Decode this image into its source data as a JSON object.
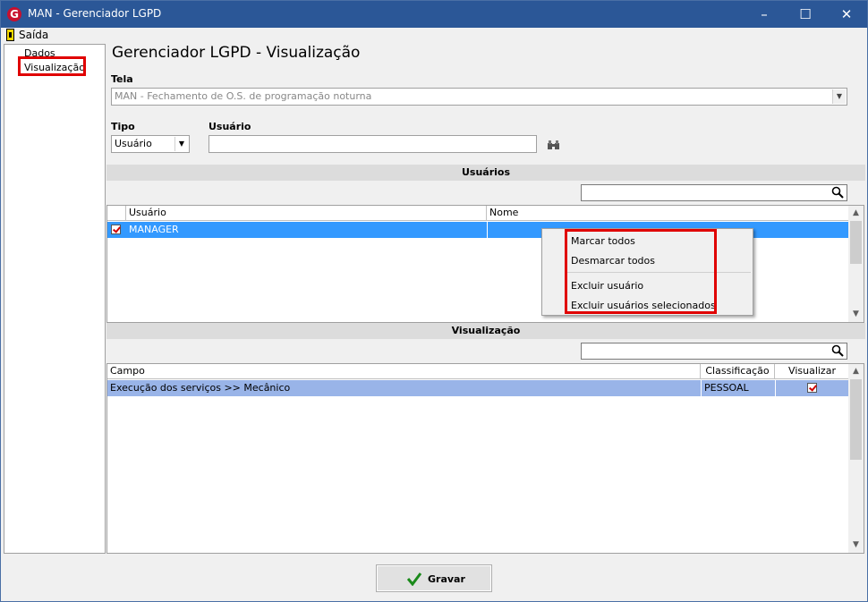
{
  "window": {
    "title": "MAN - Gerenciador LGPD",
    "app_icon_letter": "G"
  },
  "titlebar_buttons": {
    "minimize": "–",
    "maximize": "☐",
    "close": "✕"
  },
  "menubar": {
    "saida": "Saída"
  },
  "tree": {
    "items": [
      "Dados",
      "Visualização"
    ]
  },
  "heading": "Gerenciador LGPD - Visualização",
  "tela": {
    "label": "Tela",
    "value": "MAN - Fechamento de O.S. de programação noturna"
  },
  "tipo": {
    "label": "Tipo",
    "value": "Usuário"
  },
  "usuario_field": {
    "label": "Usuário",
    "value": ""
  },
  "usuarios_section": {
    "title": "Usuários",
    "columns": [
      "Usuário",
      "Nome"
    ],
    "rows": [
      {
        "checked": true,
        "usuario": "MANAGER",
        "nome": ""
      }
    ]
  },
  "context_menu": {
    "items": [
      "Marcar todos",
      "Desmarcar todos",
      "Excluir usuário",
      "Excluir usuários selecionados"
    ]
  },
  "visualizacao_section": {
    "title": "Visualização",
    "columns": [
      "Campo",
      "Classificação",
      "Visualizar"
    ],
    "rows": [
      {
        "campo": "Execução dos serviços >> Mecânico",
        "classificacao": "PESSOAL",
        "visualizar": true
      }
    ]
  },
  "gravar_button": {
    "label": "Gravar"
  },
  "colors": {
    "titlebar": "#2b5797",
    "selection": "#3399ff",
    "selection_light": "#99b4e8",
    "highlight_box": "#e00000"
  }
}
